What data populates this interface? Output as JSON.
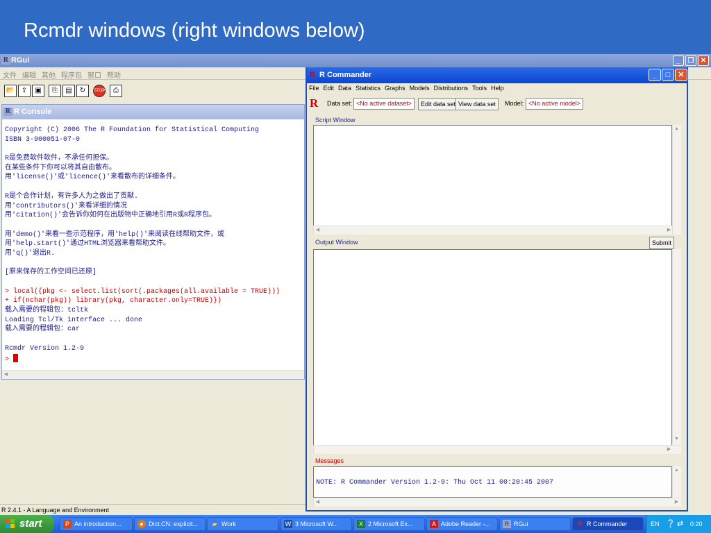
{
  "slide_title": "Rcmdr windows (right windows below)",
  "rgui": {
    "title": "RGui",
    "menu": [
      "文件",
      "编辑",
      "其他",
      "程序包",
      "窗口",
      "帮助"
    ],
    "status": "R 2.4.1 - A Language and Environment"
  },
  "console": {
    "title": "R Console",
    "lines": [
      {
        "t": "Copyright (C) 2006 The R Foundation for Statistical Computing",
        "c": "blue"
      },
      {
        "t": "ISBN 3-900051-07-0",
        "c": "blue"
      },
      {
        "t": "",
        "c": "blue"
      },
      {
        "t": "R是免费软件软件，不承任何担保。",
        "c": "blue"
      },
      {
        "t": "在某些条件下你可以将其自由散布。",
        "c": "blue"
      },
      {
        "t": "用'license()'或'licence()'来看散布的详细条件。",
        "c": "blue"
      },
      {
        "t": "",
        "c": "blue"
      },
      {
        "t": "R是个合作计划，有许多人为之做出了贡献.",
        "c": "blue"
      },
      {
        "t": "用'contributors()'来看详细的情况",
        "c": "blue"
      },
      {
        "t": "用'citation()'会告诉你如何在出版物中正确地引用R或R程序包。",
        "c": "blue"
      },
      {
        "t": "",
        "c": "blue"
      },
      {
        "t": "用'demo()'来看一些示范程序，用'help()'来阅读在线帮助文件，或",
        "c": "blue"
      },
      {
        "t": "用'help.start()'通过HTML浏览器来看帮助文件。",
        "c": "blue"
      },
      {
        "t": "用'q()'退出R.",
        "c": "blue"
      },
      {
        "t": "",
        "c": "blue"
      },
      {
        "t": "[原来保存的工作空间已还原]",
        "c": "blue"
      },
      {
        "t": "",
        "c": "blue"
      },
      {
        "t": "> local({pkg <- select.list(sort(.packages(all.available = TRUE)))",
        "c": "red"
      },
      {
        "t": "+ if(nchar(pkg)) library(pkg, character.only=TRUE)})",
        "c": "red"
      },
      {
        "t": "载入需要的程辑包：tcltk",
        "c": "blue"
      },
      {
        "t": "Loading Tcl/Tk interface ... done",
        "c": "blue"
      },
      {
        "t": "载入需要的程辑包：car",
        "c": "blue"
      },
      {
        "t": "",
        "c": "blue"
      },
      {
        "t": "Rcmdr Version 1.2-9",
        "c": "blue"
      }
    ],
    "prompt": ">"
  },
  "rcmdr": {
    "title": "R Commander",
    "menu": [
      "File",
      "Edit",
      "Data",
      "Statistics",
      "Graphs",
      "Models",
      "Distributions",
      "Tools",
      "Help"
    ],
    "dataset_label": "Data set:",
    "dataset_value": "<No active dataset>",
    "edit_btn": "Edit data set",
    "view_btn": "View data set",
    "model_label": "Model:",
    "model_value": "<No active model>",
    "script_label": "Script Window",
    "output_label": "Output Window",
    "submit_btn": "Submit",
    "messages_label": "Messages",
    "message_text": "NOTE: R Commander Version 1.2-9: Thu Oct 11 00:20:45 2007"
  },
  "taskbar": {
    "start": "start",
    "tasks": [
      {
        "label": "An introduction...",
        "icon": "ppt-icon"
      },
      {
        "label": "Dict.CN: explicit...",
        "icon": "firefox-icon"
      },
      {
        "label": "Work",
        "icon": "folder-icon"
      },
      {
        "label": "3 Microsoft W...",
        "icon": "word-icon"
      },
      {
        "label": "2 Microsoft Ex...",
        "icon": "excel-icon"
      },
      {
        "label": "Adobe Reader -...",
        "icon": "acrobat-icon"
      },
      {
        "label": "RGui",
        "icon": "r-icon"
      },
      {
        "label": "R Commander",
        "icon": "r-icon"
      }
    ],
    "lang": "EN",
    "clock": "0:20"
  },
  "colors": {
    "accent": "#2f6bc4",
    "xp_title": "#0b46d0",
    "console_red": "#c00000"
  }
}
